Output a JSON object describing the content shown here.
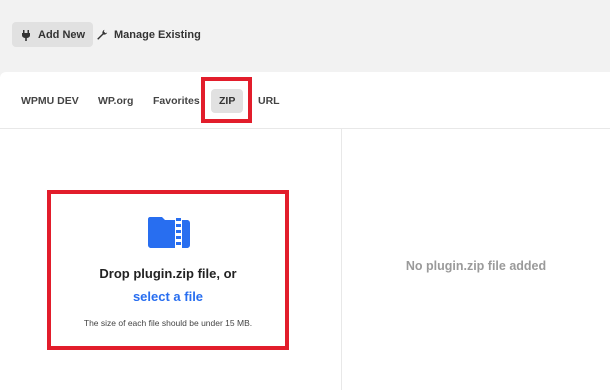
{
  "toolbar": {
    "add_new": "Add New",
    "manage_existing": "Manage Existing"
  },
  "tabs": [
    {
      "label": "WPMU DEV"
    },
    {
      "label": "WP.org"
    },
    {
      "label": "Favorites"
    },
    {
      "label": "ZIP"
    },
    {
      "label": "URL"
    }
  ],
  "dropzone": {
    "title": "Drop plugin.zip file, or",
    "link": "select a file",
    "note": "The size of each file should be under 15 MB."
  },
  "preview": {
    "empty_text": "No plugin.zip file added"
  },
  "colors": {
    "accent": "#286ef0",
    "highlight": "#e21d2b"
  },
  "icons": {
    "add_new": "plug-icon",
    "manage_existing": "wrench-icon",
    "dropzone": "zip-folder-icon"
  }
}
